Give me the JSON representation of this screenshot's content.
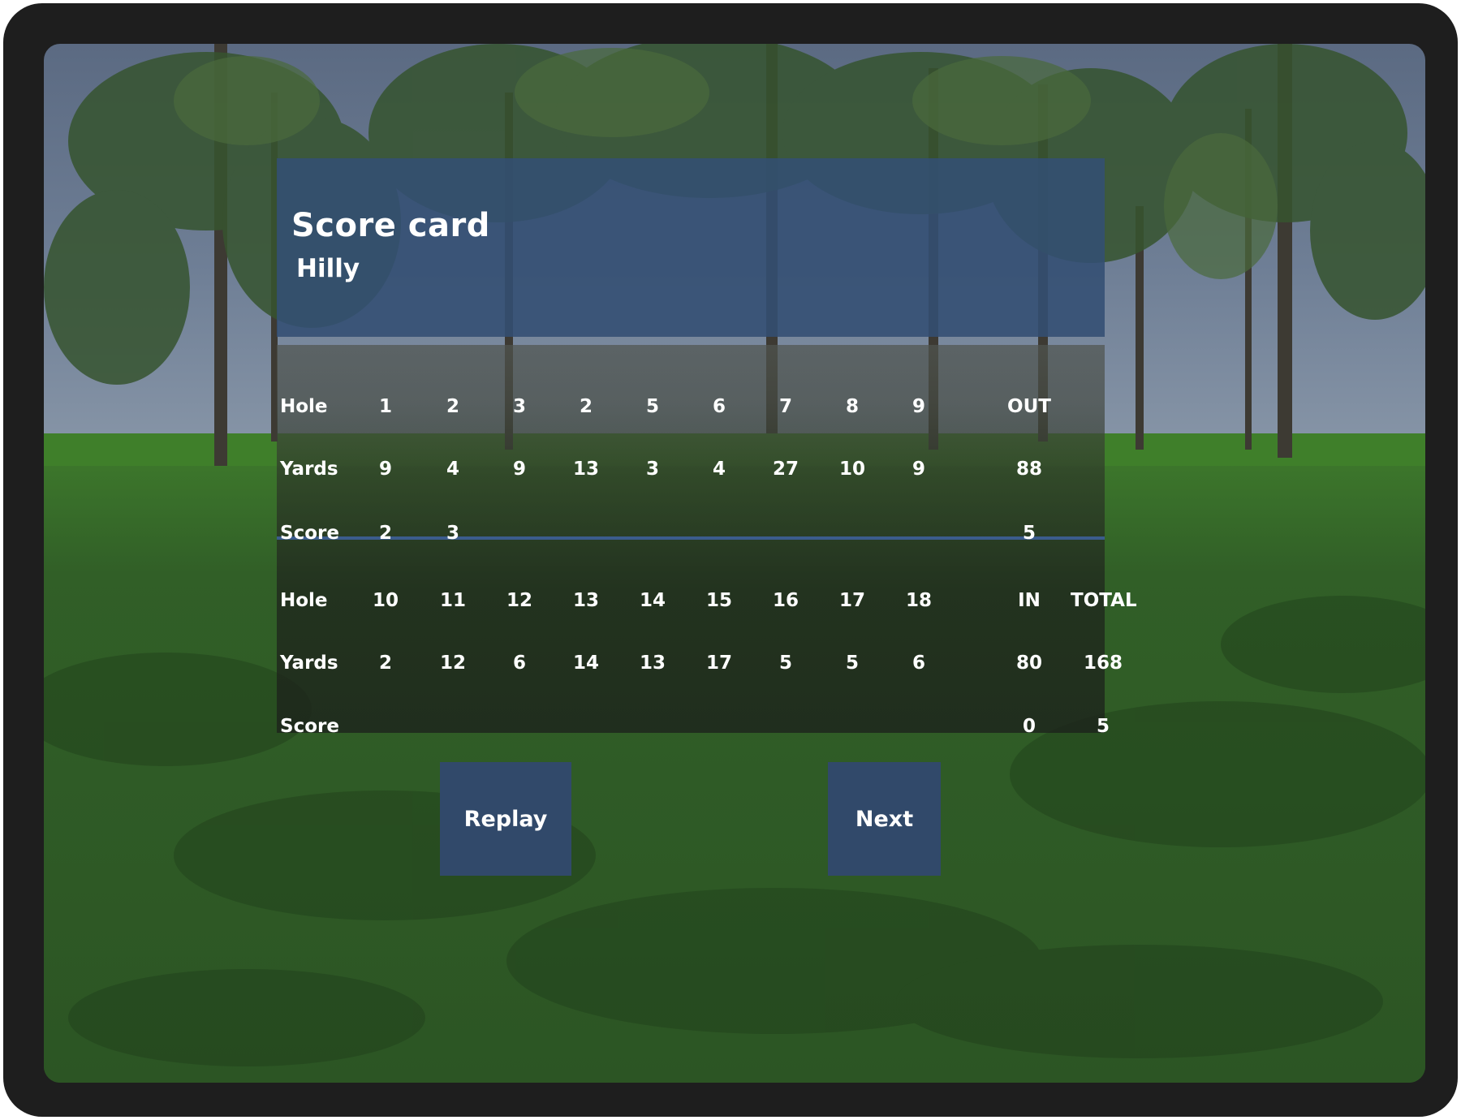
{
  "scorecard": {
    "title": "Score card",
    "course": "Hilly",
    "front": {
      "hole_label": "Hole",
      "yards_label": "Yards",
      "score_label": "Score",
      "holes": [
        "1",
        "2",
        "3",
        "2",
        "5",
        "6",
        "7",
        "8",
        "9",
        "OUT"
      ],
      "yards": [
        "9",
        "4",
        "9",
        "13",
        "3",
        "4",
        "27",
        "10",
        "9",
        "88"
      ],
      "scores": [
        "2",
        "3",
        "",
        "",
        "",
        "",
        "",
        "",
        "",
        "5"
      ]
    },
    "back": {
      "hole_label": "Hole",
      "yards_label": "Yards",
      "score_label": "Score",
      "holes": [
        "10",
        "11",
        "12",
        "13",
        "14",
        "15",
        "16",
        "17",
        "18",
        "IN",
        "TOTAL"
      ],
      "yards": [
        "2",
        "12",
        "6",
        "14",
        "13",
        "17",
        "5",
        "5",
        "6",
        "80",
        "168"
      ],
      "scores": [
        "",
        "",
        "",
        "",
        "",
        "",
        "",
        "",
        "",
        "0",
        "5"
      ]
    }
  },
  "buttons": {
    "replay": "Replay",
    "next": "Next"
  },
  "colors": {
    "header_panel": "#334e73",
    "divider": "#3b5c8c",
    "button": "#31496a"
  }
}
